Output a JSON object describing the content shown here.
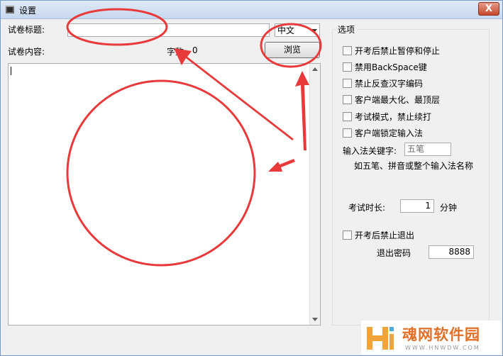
{
  "window": {
    "title": "设置",
    "close_label": "X"
  },
  "left": {
    "paper_title_label": "试卷标题:",
    "paper_title_value": "",
    "language_selected": "中文",
    "content_label": "试卷内容:",
    "char_count_label": "字数:",
    "char_count_value": "0",
    "browse_label": "浏览",
    "content_value": ""
  },
  "options": {
    "group_title": "选项",
    "checkboxes": [
      {
        "label": "开考后禁止暂停和停止",
        "checked": false
      },
      {
        "label": "禁用BackSpace键",
        "checked": false
      },
      {
        "label": "禁止反查汉字编码",
        "checked": false
      },
      {
        "label": "客户端最大化、最顶层",
        "checked": false
      },
      {
        "label": "考试模式，禁止续打",
        "checked": false
      },
      {
        "label": "客户端锁定输入法",
        "checked": false
      }
    ],
    "ime_keyword_label": "输入法关键字:",
    "ime_keyword_value": "五笔",
    "ime_hint": "如五笔、拼音或整个输入法名称",
    "duration_label": "考试时长:",
    "duration_value": "1",
    "duration_unit": "分钟",
    "forbid_exit_label": "开考后禁止退出",
    "forbid_exit_checked": false,
    "exit_password_label": "退出密码",
    "exit_password_value": "8888"
  },
  "watermark": {
    "brand": "魂网软件园",
    "url": "WWW.HNWDW.COM"
  },
  "colors": {
    "annotation_red": "#e8393b",
    "brand_orange": "#e0702a"
  }
}
